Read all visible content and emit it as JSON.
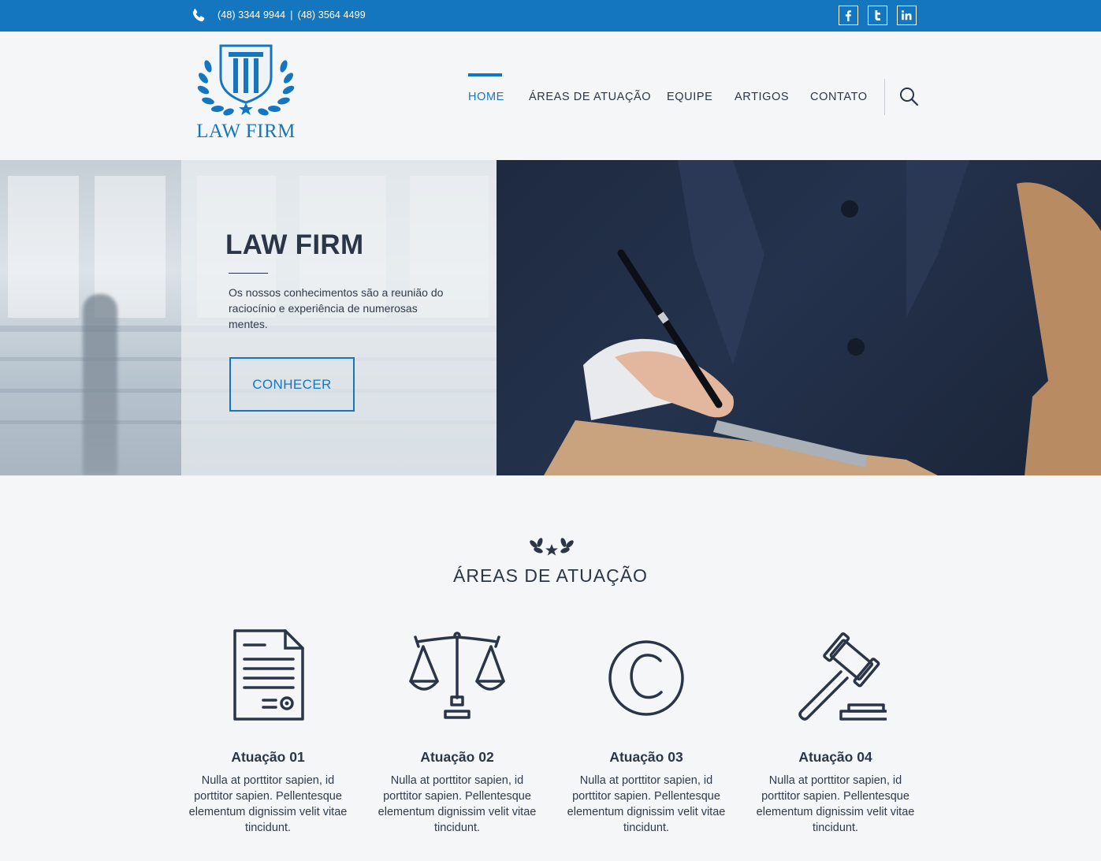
{
  "topbar": {
    "phone_1": "(48) 3344 9944",
    "separator": "|",
    "phone_2": "(48) 3564 4499",
    "social": [
      "facebook-icon",
      "twitter-icon",
      "linkedin-icon"
    ]
  },
  "header": {
    "logo_text": "LAW FIRM",
    "nav": [
      "HOME",
      "ÁREAS DE ATUAÇÃO",
      "EQUIPE",
      "ARTIGOS",
      "CONTATO"
    ],
    "active_nav": "HOME"
  },
  "hero": {
    "title": "LAW FIRM",
    "text": "Os nossos conhecimentos são a reunião do raciocínio e experiência de numerosas mentes.",
    "button": "CONHECER"
  },
  "areas": {
    "title": "ÁREAS DE ATUAÇÃO",
    "items": [
      {
        "title": "Atuação 01",
        "icon": "document-icon",
        "text": "Nulla at porttitor sapien, id porttitor sapien. Pellentesque elementum dignissim velit vitae tincidunt."
      },
      {
        "title": "Atuação 02",
        "icon": "scales-icon",
        "text": "Nulla at porttitor sapien, id porttitor sapien. Pellentesque elementum dignissim velit vitae tincidunt."
      },
      {
        "title": "Atuação 03",
        "icon": "copyright-icon",
        "text": "Nulla at porttitor sapien, id porttitor sapien. Pellentesque elementum dignissim velit vitae tincidunt."
      },
      {
        "title": "Atuação 04",
        "icon": "gavel-icon",
        "text": "Nulla at porttitor sapien, id porttitor sapien. Pellentesque elementum dignissim velit vitae tincidunt."
      }
    ]
  },
  "colors": {
    "brand_blue": "#1576c0",
    "dark_navy": "#2a3648",
    "page_bg": "#f5f6f7"
  }
}
